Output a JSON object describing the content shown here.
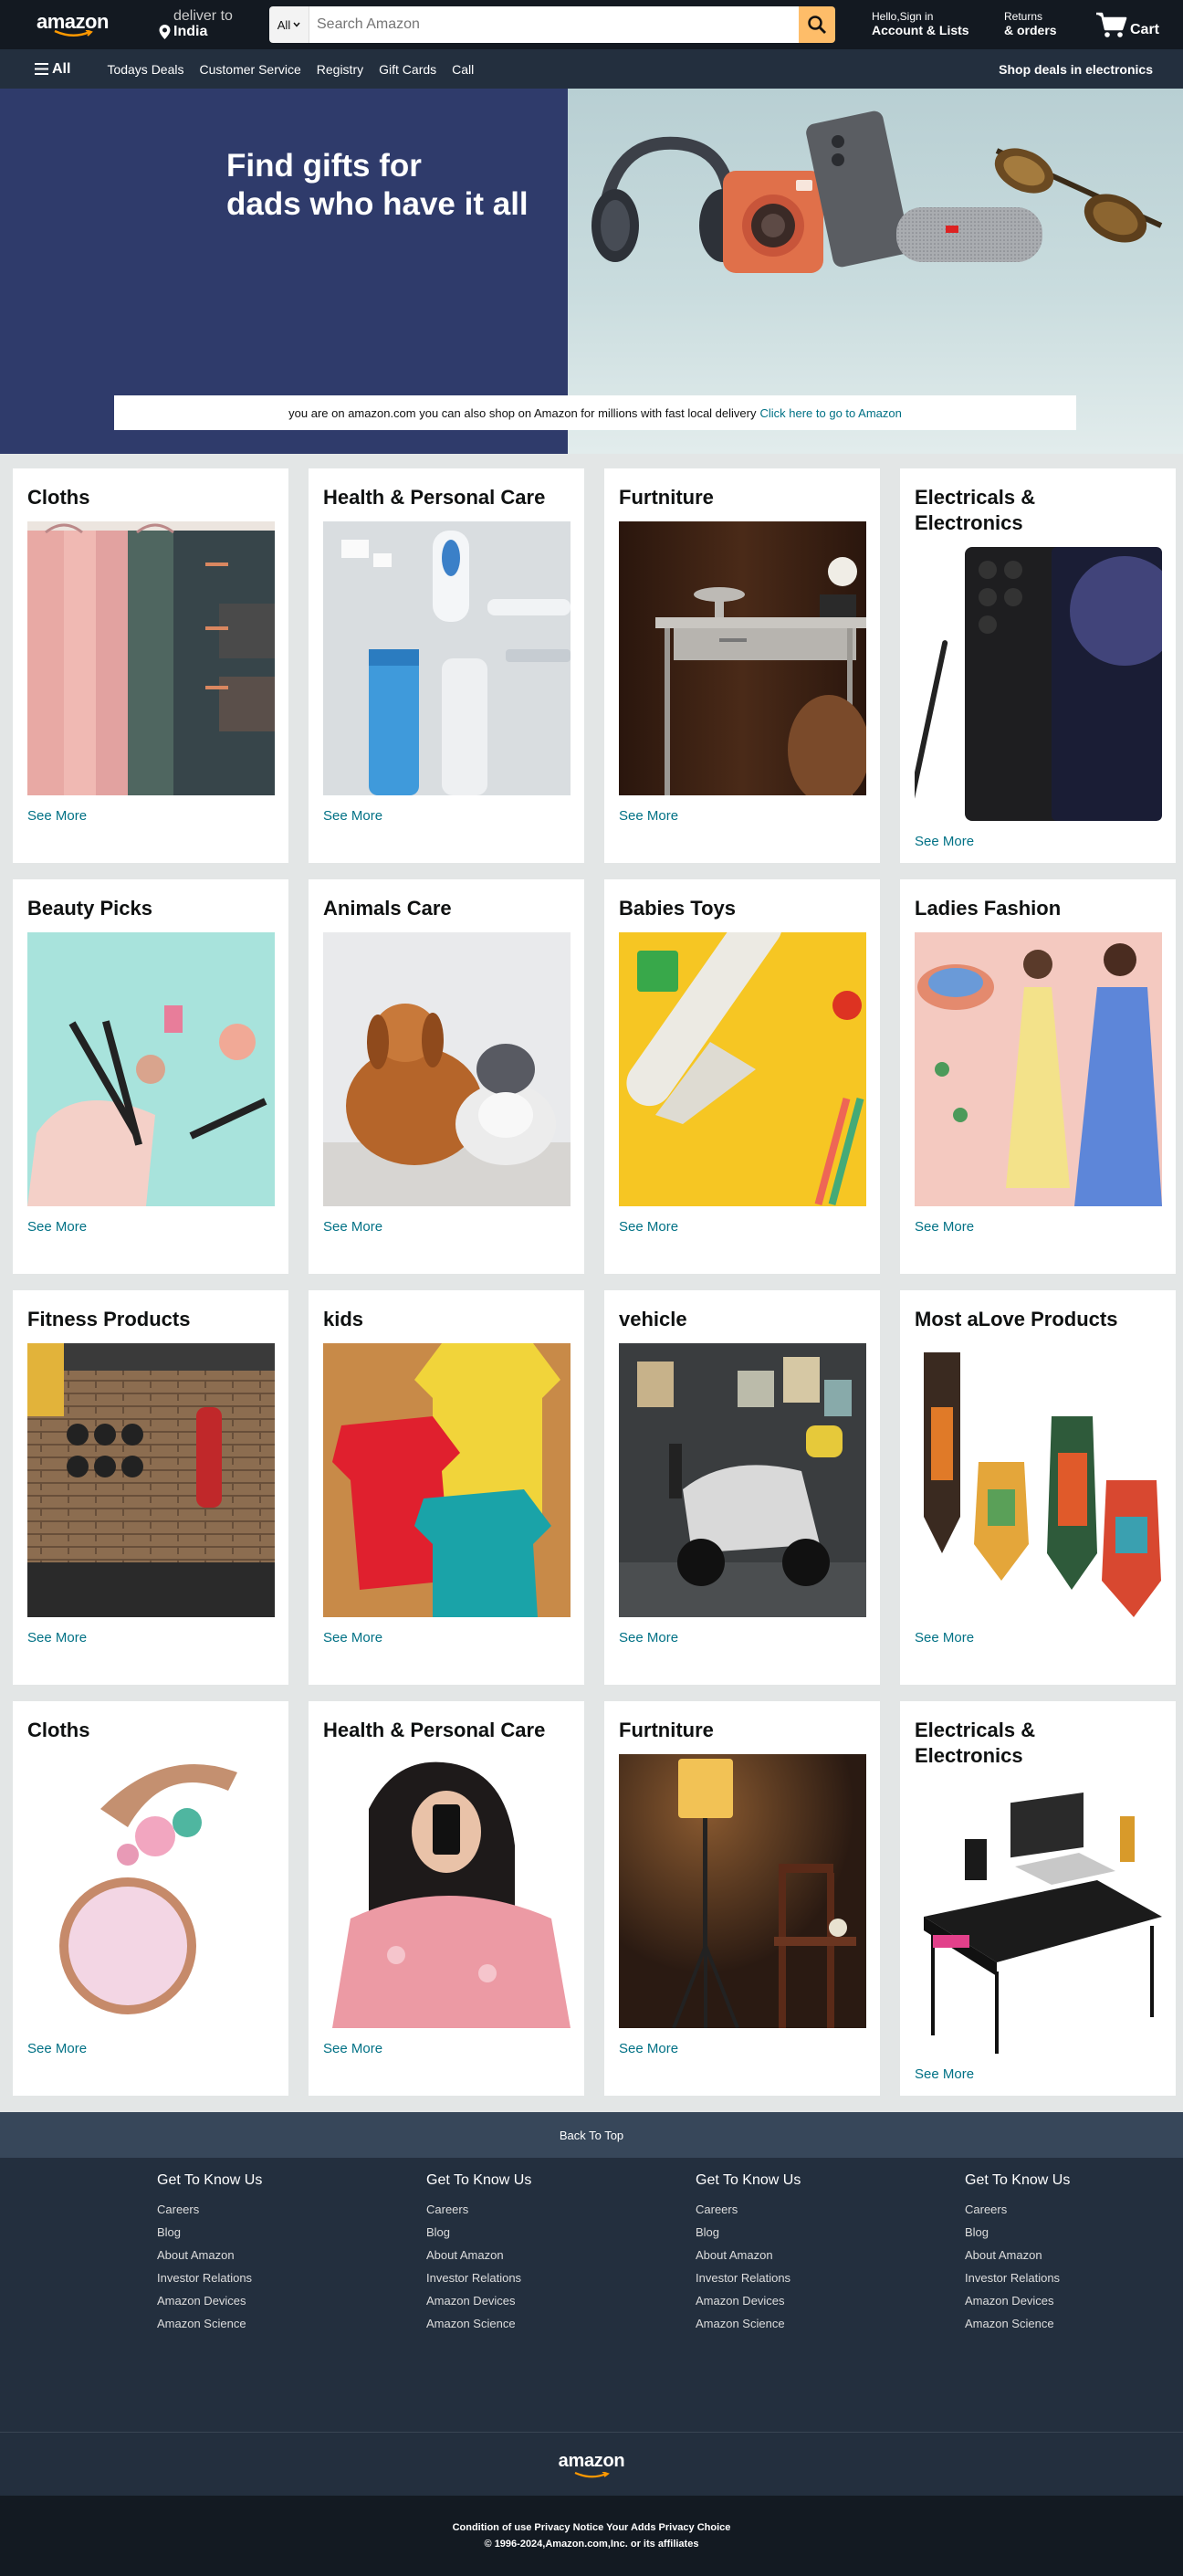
{
  "nav": {
    "logo": "amazon",
    "deliver_top": "deliver to",
    "deliver_location": "India",
    "search_category": "All",
    "search_placeholder": "Search Amazon",
    "account_small": "Hello,Sign in",
    "account_bold": "Account & Lists",
    "returns_small": "Returns",
    "returns_bold": "& orders",
    "cart_label": "Cart"
  },
  "subnav": {
    "all_label": "All",
    "links": [
      "Todays Deals",
      "Customer Service",
      "Registry",
      "Gift Cards",
      "Call"
    ],
    "right_label": "Shop deals in electronics"
  },
  "hero": {
    "title_line1": "Find gifts for",
    "title_line2": "dads who have it all",
    "notice_text": "you are on amazon.com you can also shop on Amazon for millions with fast local delivery",
    "notice_link": "Click here to go to Amazon"
  },
  "cards": [
    {
      "title": "Cloths",
      "link": "See More",
      "img": "towels"
    },
    {
      "title": "Health & Personal Care",
      "link": "See More",
      "img": "health"
    },
    {
      "title": "Furtniture",
      "link": "See More",
      "img": "desk"
    },
    {
      "title": "Electricals & Electronics",
      "link": "See More",
      "img": "phone"
    },
    {
      "title": "Beauty Picks",
      "link": "See More",
      "img": "makeup"
    },
    {
      "title": "Animals Care",
      "link": "See More",
      "img": "pets"
    },
    {
      "title": "Babies Toys",
      "link": "See More",
      "img": "toys"
    },
    {
      "title": "Ladies Fashion",
      "link": "See More",
      "img": "fashion"
    },
    {
      "title": "Fitness Products",
      "link": "See More",
      "img": "gym"
    },
    {
      "title": "kids",
      "link": "See More",
      "img": "shirts"
    },
    {
      "title": "vehicle",
      "link": "See More",
      "img": "scooter"
    },
    {
      "title": "Most aLove Products",
      "link": "See More",
      "img": "masks"
    },
    {
      "title": "Cloths",
      "link": "See More",
      "img": "watch"
    },
    {
      "title": "Health & Personal Care",
      "link": "See More",
      "img": "selfie"
    },
    {
      "title": "Furtniture",
      "link": "See More",
      "img": "lamp"
    },
    {
      "title": "Electricals & Electronics",
      "link": "See More",
      "img": "laptopdesk"
    }
  ],
  "back_to_top": "Back To Top",
  "footer": {
    "columns": [
      {
        "head": "Get To Know Us",
        "links": [
          "Careers",
          "Blog",
          "About Amazon",
          "Investor Relations",
          "Amazon Devices",
          "Amazon Science"
        ]
      },
      {
        "head": "Get To Know Us",
        "links": [
          "Careers",
          "Blog",
          "About Amazon",
          "Investor Relations",
          "Amazon Devices",
          "Amazon Science"
        ]
      },
      {
        "head": "Get To Know Us",
        "links": [
          "Careers",
          "Blog",
          "About Amazon",
          "Investor Relations",
          "Amazon Devices",
          "Amazon Science"
        ]
      },
      {
        "head": "Get To Know Us",
        "links": [
          "Careers",
          "Blog",
          "About Amazon",
          "Investor Relations",
          "Amazon Devices",
          "Amazon Science"
        ]
      }
    ],
    "logo": "amazon",
    "bottom_line1": "Condition of use Privacy Notice Your Adds Privacy Choice",
    "bottom_line2": "© 1996-2024,Amazon.com,Inc. or its affiliates"
  },
  "colors": {
    "nav_bg": "#131921",
    "subnav_bg": "#232f3e",
    "search_button": "#febd69",
    "link": "#007185",
    "hero_left": "#2f3b6b",
    "back_to_top": "#37475a"
  }
}
